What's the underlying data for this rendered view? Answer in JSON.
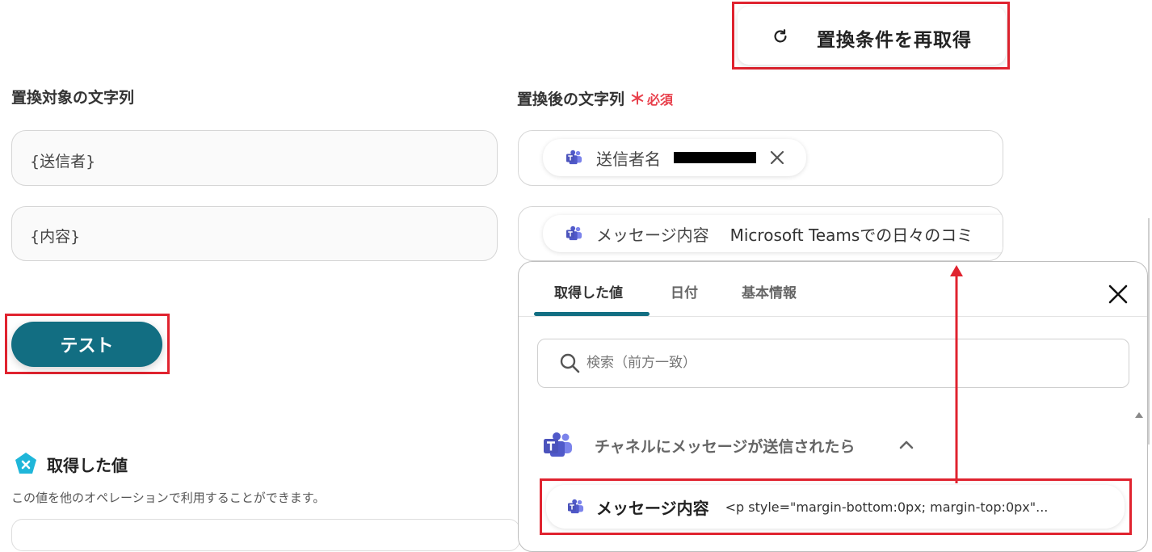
{
  "refetch": {
    "label": "置換条件を再取得",
    "icon": "refresh-icon"
  },
  "target": {
    "label": "置換対象の文字列",
    "values": [
      "{送信者}",
      "{内容}"
    ]
  },
  "replacement": {
    "label": "置換後の文字列",
    "required_mark": "＊",
    "required_text": "必須",
    "chips": [
      {
        "label": "送信者名",
        "value": "",
        "icon": "teams-icon"
      },
      {
        "label": "メッセージ内容",
        "value": "Microsoft Teamsでの日々のコミ",
        "icon": "teams-icon"
      }
    ]
  },
  "test_button": {
    "label": "テスト"
  },
  "fetched": {
    "title": "取得した値",
    "description": "この値を他のオペレーションで利用することができます。"
  },
  "panel": {
    "tabs": [
      "取得した値",
      "日付",
      "基本情報"
    ],
    "active_tab": 0,
    "search_placeholder": "検索（前方一致）",
    "group_label": "チャネルにメッセージが送信されたら",
    "item": {
      "label": "メッセージ内容",
      "value": "<p style=\"margin-bottom:0px; margin-top:0px\"..."
    }
  },
  "colors": {
    "accent": "#126e82",
    "highlight": "#e0232f",
    "required": "#e8404c",
    "teams": "#5059c9"
  }
}
